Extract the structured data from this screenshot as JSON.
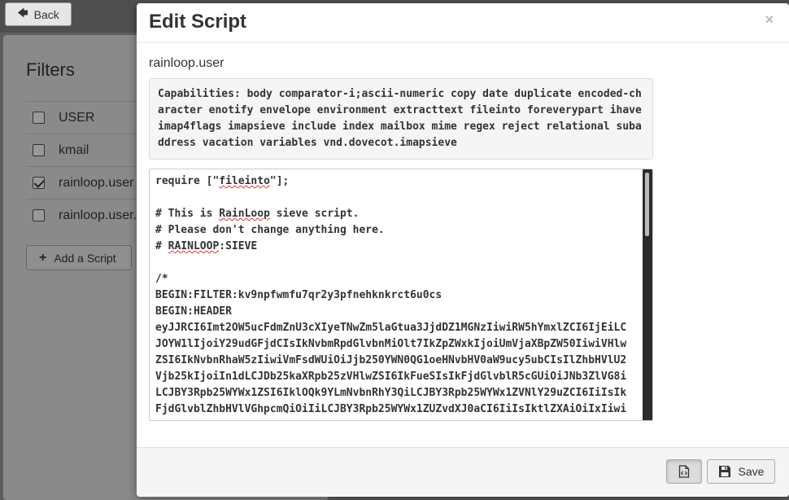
{
  "background": {
    "back_label": "Back",
    "filters_title": "Filters",
    "filters": [
      {
        "name": "USER",
        "checked": false
      },
      {
        "name": "kmail",
        "checked": false
      },
      {
        "name": "rainloop.user",
        "checked": true
      },
      {
        "name": "rainloop.user.",
        "checked": false
      }
    ],
    "add_script_label": "Add a Script"
  },
  "modal": {
    "title": "Edit Script",
    "close_glyph": "×",
    "script_name": "rainloop.user",
    "capabilities": "Capabilities: body comparator-i;ascii-numeric copy date duplicate encoded-character enotify envelope environment extracttext fileinto foreverypart ihave imap4flags imapsieve include index mailbox mime regex reject relational subaddress vacation variables vnd.dovecot.imapsieve",
    "editor": {
      "line1_pre": "require [\"",
      "line1_word": "fileinto",
      "line1_post": "\"];",
      "line3_pre": "# This is ",
      "line3_word": "RainLoop",
      "line3_post": " sieve script.",
      "line4": "# Please don't change anything here.",
      "line5_pre": "# ",
      "line5_word": "RAINLOOP",
      "line5_post": ":SIEVE",
      "line7": "/*",
      "line8": "BEGIN:FILTER:kv9npfwmfu7qr2y3pfnehknkrct6u0cs",
      "line9": "BEGIN:HEADER",
      "line10": "eyJJRCI6Imt2OW5ucFdmZnU3cXIyeTNwZm5laGtua3JjdDZ1MGNzIiwiRW5hYmxlZCI6IjEiLC",
      "line11": "JOYW1lIjoiY29udGFjdCIsIkNvbmRpdGlvbnMiOlt7IkZpZWxkIjoiUmVjaXBpZW50IiwiVHlw",
      "line12": "ZSI6IkNvbnRhaW5zIiwiVmFsdWUiOiJjb250YWN0QG1oeHNvbHV0aW9ucy5ubCIsIlZhbHVlU2",
      "line13": "Vjb25kIjoiIn1dLCJDb25kaXRpb25zVHlwZSI6IkFueSIsIkFjdGlvblR5cGUiOiJNb3ZlVG8i",
      "line14": "LCJBY3Rpb25WYWx1ZSI6IklOQk9YLmNvbnRhY3QiLCJBY3Rpb25WYWx1ZVNlY29uZCI6IiIsIk",
      "line15": "FjdGlvblZhbHVlVGhpcmQiOiIiLCJBY3Rpb25WYWx1ZUZvdXJ0aCI6IiIsIktlZXAiOiIxIiwi"
    },
    "save_label": "Save"
  }
}
